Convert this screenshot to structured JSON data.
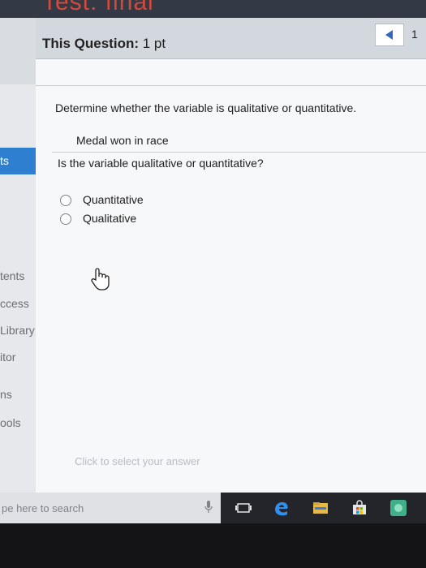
{
  "window": {
    "title": "Test: final"
  },
  "sidebar": {
    "active_label": "ts",
    "items": [
      "tents",
      "ccess",
      "Library",
      "itor",
      "ns",
      "ools"
    ]
  },
  "header": {
    "label": "This Question:",
    "points": "1 pt",
    "question_number": "1"
  },
  "question": {
    "prompt": "Determine whether the variable is qualitative or quantitative.",
    "variable": "Medal won in race",
    "ask": "Is the variable qualitative or quantitative?",
    "options": [
      "Quantitative",
      "Qualitative"
    ],
    "hint": "Click to select your answer"
  },
  "taskbar": {
    "search_placeholder": "pe here to search",
    "icons": [
      "microphone-icon",
      "task-view-icon",
      "edge-browser-icon",
      "file-explorer-icon",
      "store-icon",
      "app-icon"
    ]
  },
  "colors": {
    "accent": "#2e7fd0",
    "title_red": "#d24a3c",
    "header_bg": "#d3d8de"
  }
}
